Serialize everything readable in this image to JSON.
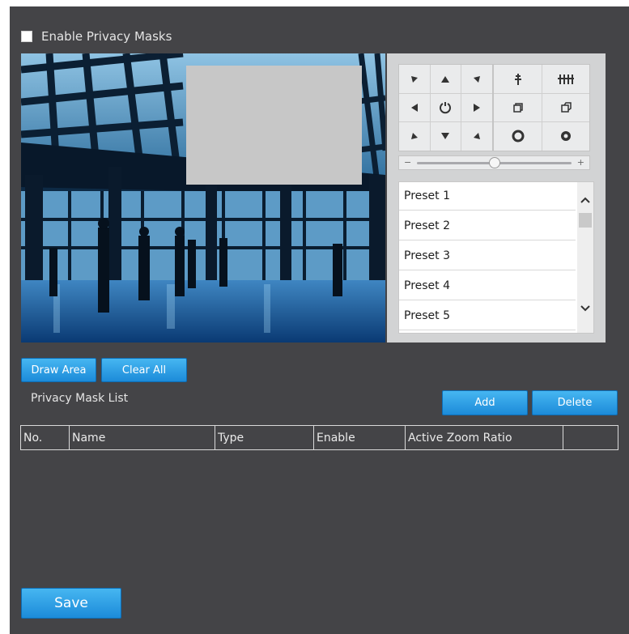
{
  "privacy": {
    "enable_label": "Enable Privacy Masks",
    "enable_checked": false
  },
  "ptz": {
    "speed_level": 0.5,
    "presets": [
      "Preset 1",
      "Preset 2",
      "Preset 3",
      "Preset 4",
      "Preset 5"
    ]
  },
  "actions": {
    "draw_area": "Draw Area",
    "clear_all": "Clear All",
    "add": "Add",
    "delete": "Delete",
    "save": "Save"
  },
  "mask_list": {
    "title": "Privacy Mask List",
    "columns": [
      "No.",
      "Name",
      "Type",
      "Enable",
      "Active Zoom Ratio",
      ""
    ]
  },
  "colors": {
    "background": "#444447",
    "button": "#2a9be6",
    "mask": "#c7c7c7",
    "ptz_panel": "#d2d3d4"
  }
}
